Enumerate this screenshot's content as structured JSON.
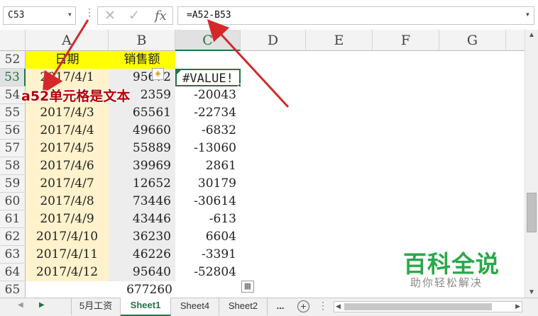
{
  "formula_bar": {
    "name_box": "C53",
    "formula": "=A52-B53"
  },
  "columns": [
    "A",
    "B",
    "C",
    "D",
    "E",
    "F",
    "G"
  ],
  "selected_column": "C",
  "rows": [
    {
      "num": "52",
      "a": "日期",
      "b": "销售额",
      "c": ""
    },
    {
      "num": "53",
      "a": "2017/4/1",
      "b": "95672",
      "c": "#VALUE!"
    },
    {
      "num": "54",
      "a": "",
      "b": "2359",
      "c": "-20043"
    },
    {
      "num": "55",
      "a": "2017/4/3",
      "b": "65561",
      "c": "-22734"
    },
    {
      "num": "56",
      "a": "2017/4/4",
      "b": "49660",
      "c": "-6832"
    },
    {
      "num": "57",
      "a": "2017/4/5",
      "b": "55889",
      "c": "-13060"
    },
    {
      "num": "58",
      "a": "2017/4/6",
      "b": "39969",
      "c": "2861"
    },
    {
      "num": "59",
      "a": "2017/4/7",
      "b": "12652",
      "c": "30179"
    },
    {
      "num": "60",
      "a": "2017/4/8",
      "b": "73446",
      "c": "-30614"
    },
    {
      "num": "61",
      "a": "2017/4/9",
      "b": "43446",
      "c": "-613"
    },
    {
      "num": "62",
      "a": "2017/4/10",
      "b": "36230",
      "c": "6604"
    },
    {
      "num": "63",
      "a": "2017/4/11",
      "b": "46226",
      "c": "-3391"
    },
    {
      "num": "64",
      "a": "2017/4/12",
      "b": "95640",
      "c": "-52804"
    },
    {
      "num": "65",
      "a": "",
      "b": "677260",
      "c": ""
    }
  ],
  "annotation": "a52单元格是文本",
  "sheet_tabs": [
    "5月工资",
    "Sheet1",
    "Sheet4",
    "Sheet2"
  ],
  "active_tab": "Sheet1",
  "more_tabs": "...",
  "watermark": {
    "title": "百科全说",
    "subtitle": "助你轻松解决"
  },
  "colors": {
    "header_fill": "#ffff00",
    "date_fill": "#fff2cc",
    "sales_fill": "#ededed",
    "accent": "#217346",
    "annotation": "#b40000"
  }
}
